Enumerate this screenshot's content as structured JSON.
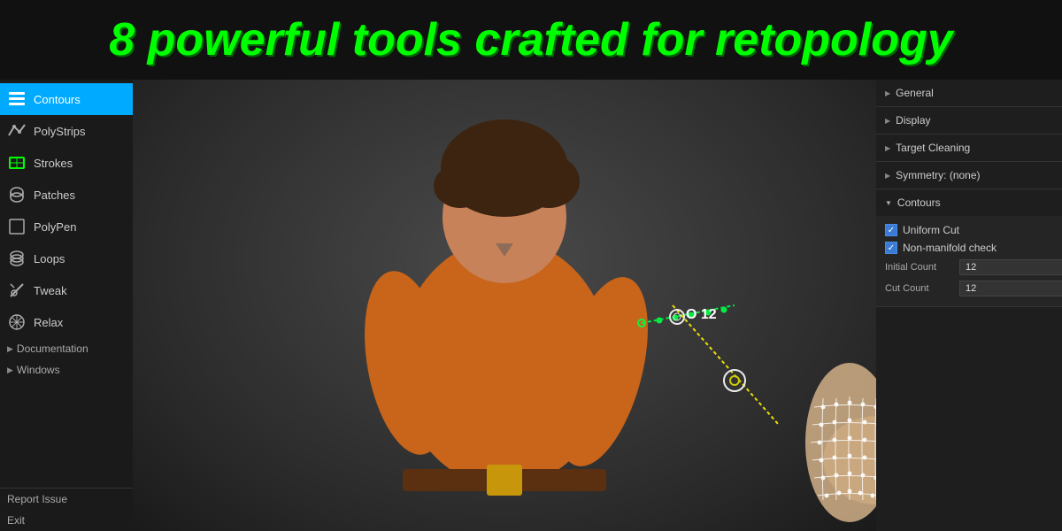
{
  "header": {
    "title": "8 powerful tools crafted for retopology"
  },
  "sidebar": {
    "items": [
      {
        "label": "Contours",
        "active": true,
        "icon": "contours"
      },
      {
        "label": "PolyStrips",
        "active": false,
        "icon": "polystrips"
      },
      {
        "label": "Strokes",
        "active": false,
        "icon": "strokes"
      },
      {
        "label": "Patches",
        "active": false,
        "icon": "patches"
      },
      {
        "label": "PolyPen",
        "active": false,
        "icon": "polypen"
      },
      {
        "label": "Loops",
        "active": false,
        "icon": "loops"
      },
      {
        "label": "Tweak",
        "active": false,
        "icon": "tweak"
      },
      {
        "label": "Relax",
        "active": false,
        "icon": "relax"
      }
    ],
    "sections": [
      {
        "label": "Documentation"
      },
      {
        "label": "Windows"
      }
    ],
    "links": [
      {
        "label": "Report Issue"
      },
      {
        "label": "Exit"
      }
    ]
  },
  "right_panel": {
    "sections": [
      {
        "label": "General",
        "open": false
      },
      {
        "label": "Display",
        "open": false
      },
      {
        "label": "Target Cleaning",
        "open": false
      },
      {
        "label": "Symmetry: (none)",
        "open": false
      },
      {
        "label": "Contours",
        "open": true,
        "items": [
          {
            "type": "checkbox",
            "checked": true,
            "label": "Uniform Cut"
          },
          {
            "type": "checkbox",
            "checked": true,
            "label": "Non-manifold check"
          },
          {
            "type": "field",
            "label": "Initial Count",
            "value": "12"
          },
          {
            "type": "field",
            "label": "Cut Count",
            "value": "12"
          }
        ]
      }
    ]
  },
  "annotation": {
    "count_label": "12"
  }
}
